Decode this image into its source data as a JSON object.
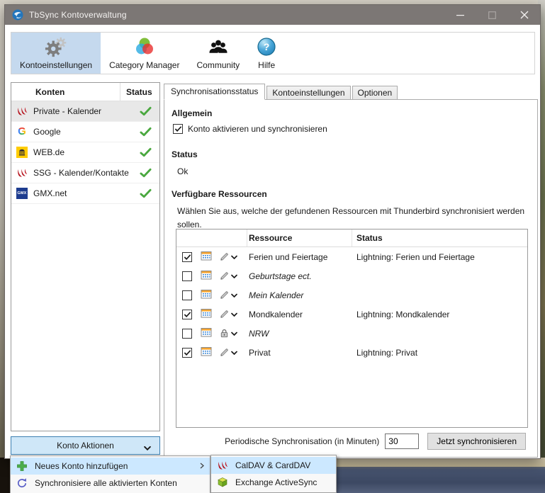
{
  "titlebar": {
    "title": "TbSync Kontoverwaltung"
  },
  "toolbar": {
    "items": [
      {
        "label": "Kontoeinstellungen",
        "icon": "gears-icon",
        "selected": true
      },
      {
        "label": "Category Manager",
        "icon": "category-circles-icon",
        "selected": false
      },
      {
        "label": "Community",
        "icon": "people-icon",
        "selected": false
      },
      {
        "label": "Hilfe",
        "icon": "help-icon",
        "selected": false
      }
    ]
  },
  "accounts": {
    "col_konten": "Konten",
    "col_status": "Status",
    "rows": [
      {
        "name": "Private - Kalender",
        "icon": "dav-icon",
        "selected": true,
        "status_ok": true
      },
      {
        "name": "Google",
        "icon": "google-icon",
        "selected": false,
        "status_ok": true
      },
      {
        "name": "WEB.de",
        "icon": "webde-icon",
        "selected": false,
        "status_ok": true
      },
      {
        "name": "SSG - Kalender/Kontakte",
        "icon": "dav-icon",
        "selected": false,
        "status_ok": true
      },
      {
        "name": "GMX.net",
        "icon": "gmx-icon",
        "selected": false,
        "status_ok": true
      }
    ],
    "actions_button": "Konto Aktionen"
  },
  "tabs": {
    "t0": "Synchronisationsstatus",
    "t1": "Kontoeinstellungen",
    "t2": "Optionen",
    "active": "Synchronisationsstatus"
  },
  "main": {
    "general_heading": "Allgemein",
    "enable_label": "Konto aktivieren und synchronisieren",
    "enable_checked": true,
    "status_heading": "Status",
    "status_value": "Ok",
    "resources_heading": "Verfügbare Ressourcen",
    "resources_hint": "Wählen Sie aus, welche der gefundenen Ressourcen mit Thunderbird synchronisiert werden sollen.",
    "table": {
      "col_resource": "Ressource",
      "col_status": "Status",
      "rows": [
        {
          "checked": true,
          "name": "Ferien und Feiertage",
          "status": "Lightning: Ferien und Feiertage",
          "italic": false,
          "action_icon": "pencil-icon"
        },
        {
          "checked": false,
          "name": "Geburtstage ect.",
          "status": "",
          "italic": true,
          "action_icon": "pencil-icon"
        },
        {
          "checked": false,
          "name": "Mein Kalender",
          "status": "",
          "italic": true,
          "action_icon": "pencil-icon"
        },
        {
          "checked": true,
          "name": "Mondkalender",
          "status": "Lightning: Mondkalender",
          "italic": false,
          "action_icon": "pencil-icon"
        },
        {
          "checked": false,
          "name": "NRW",
          "status": "",
          "italic": true,
          "action_icon": "lock-icon"
        },
        {
          "checked": true,
          "name": "Privat",
          "status": "Lightning: Privat",
          "italic": false,
          "action_icon": "pencil-icon"
        }
      ]
    },
    "periodic_label": "Periodische Synchronisation (in Minuten)",
    "periodic_value": "30",
    "sync_now": "Jetzt synchronisieren"
  },
  "menu": {
    "items": [
      {
        "label": "Neues Konto hinzufügen",
        "icon": "plus-icon",
        "highlighted": true,
        "has_submenu": true
      },
      {
        "label": "Synchronisiere alle aktivierten Konten",
        "icon": "refresh-icon",
        "highlighted": false,
        "has_submenu": false
      }
    ]
  },
  "submenu": {
    "items": [
      {
        "label": "CalDAV & CardDAV",
        "icon": "dav-icon",
        "highlighted": true
      },
      {
        "label": "Exchange ActiveSync",
        "icon": "cube-icon",
        "highlighted": false
      }
    ]
  },
  "colors": {
    "titlebar": "#7c7775",
    "toolbar_selected": "#c5d9ee",
    "menu_highlight": "#cce8ff",
    "status_check_green": "#4aa83f",
    "konto_button_bg": "#cfe7f8"
  }
}
